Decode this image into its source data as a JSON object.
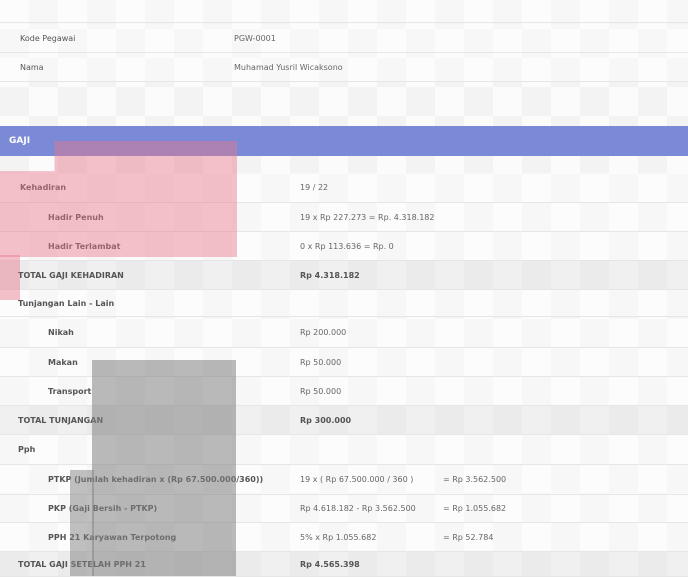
{
  "employee": {
    "code_label": "Kode Pegawai",
    "code_value": "PGW-0001",
    "name_label": "Nama",
    "name_value": "Muhamad Yusril Wicaksono"
  },
  "section_title": "GAJI",
  "attendance": {
    "label": "Kehadiran",
    "value": "19 / 22",
    "full_label": "Hadir Penuh",
    "full_value": "19 x Rp 227.273   =   Rp. 4.318.182",
    "late_label": "Hadir Terlambat",
    "late_value": "0 x Rp 113.636   =   Rp. 0",
    "total_label": "TOTAL GAJI KEHADIRAN",
    "total_value": "Rp 4.318.182"
  },
  "allowances": {
    "label": "Tunjangan Lain - Lain",
    "items": [
      {
        "label": "Nikah",
        "value": "Rp 200.000"
      },
      {
        "label": "Makan",
        "value": "Rp 50.000"
      },
      {
        "label": "Transport",
        "value": "Rp 50.000"
      }
    ],
    "total_label": "TOTAL TUNJANGAN",
    "total_value": "Rp 300.000"
  },
  "tax": {
    "label": "Pph",
    "ptkp_label": "PTKP (Jumlah kehadiran x (Rp 67.500.000/360))",
    "ptkp_formula": "19 x ( Rp 67.500.000 / 360 )",
    "ptkp_result": "=   Rp 3.562.500",
    "pkp_label": "PKP (Gaji Bersih - PTKP)",
    "pkp_formula": "Rp 4.618.182 - Rp 3.562.500",
    "pkp_result": "=   Rp 1.055.682",
    "pph21_label": "PPH 21 Karyawan Terpotong",
    "pph21_formula": "5% x Rp 1.055.682",
    "pph21_result": "=   Rp 52.784",
    "total_label": "TOTAL GAJI SETELAH PPH 21",
    "total_value": "Rp 4.565.398"
  }
}
